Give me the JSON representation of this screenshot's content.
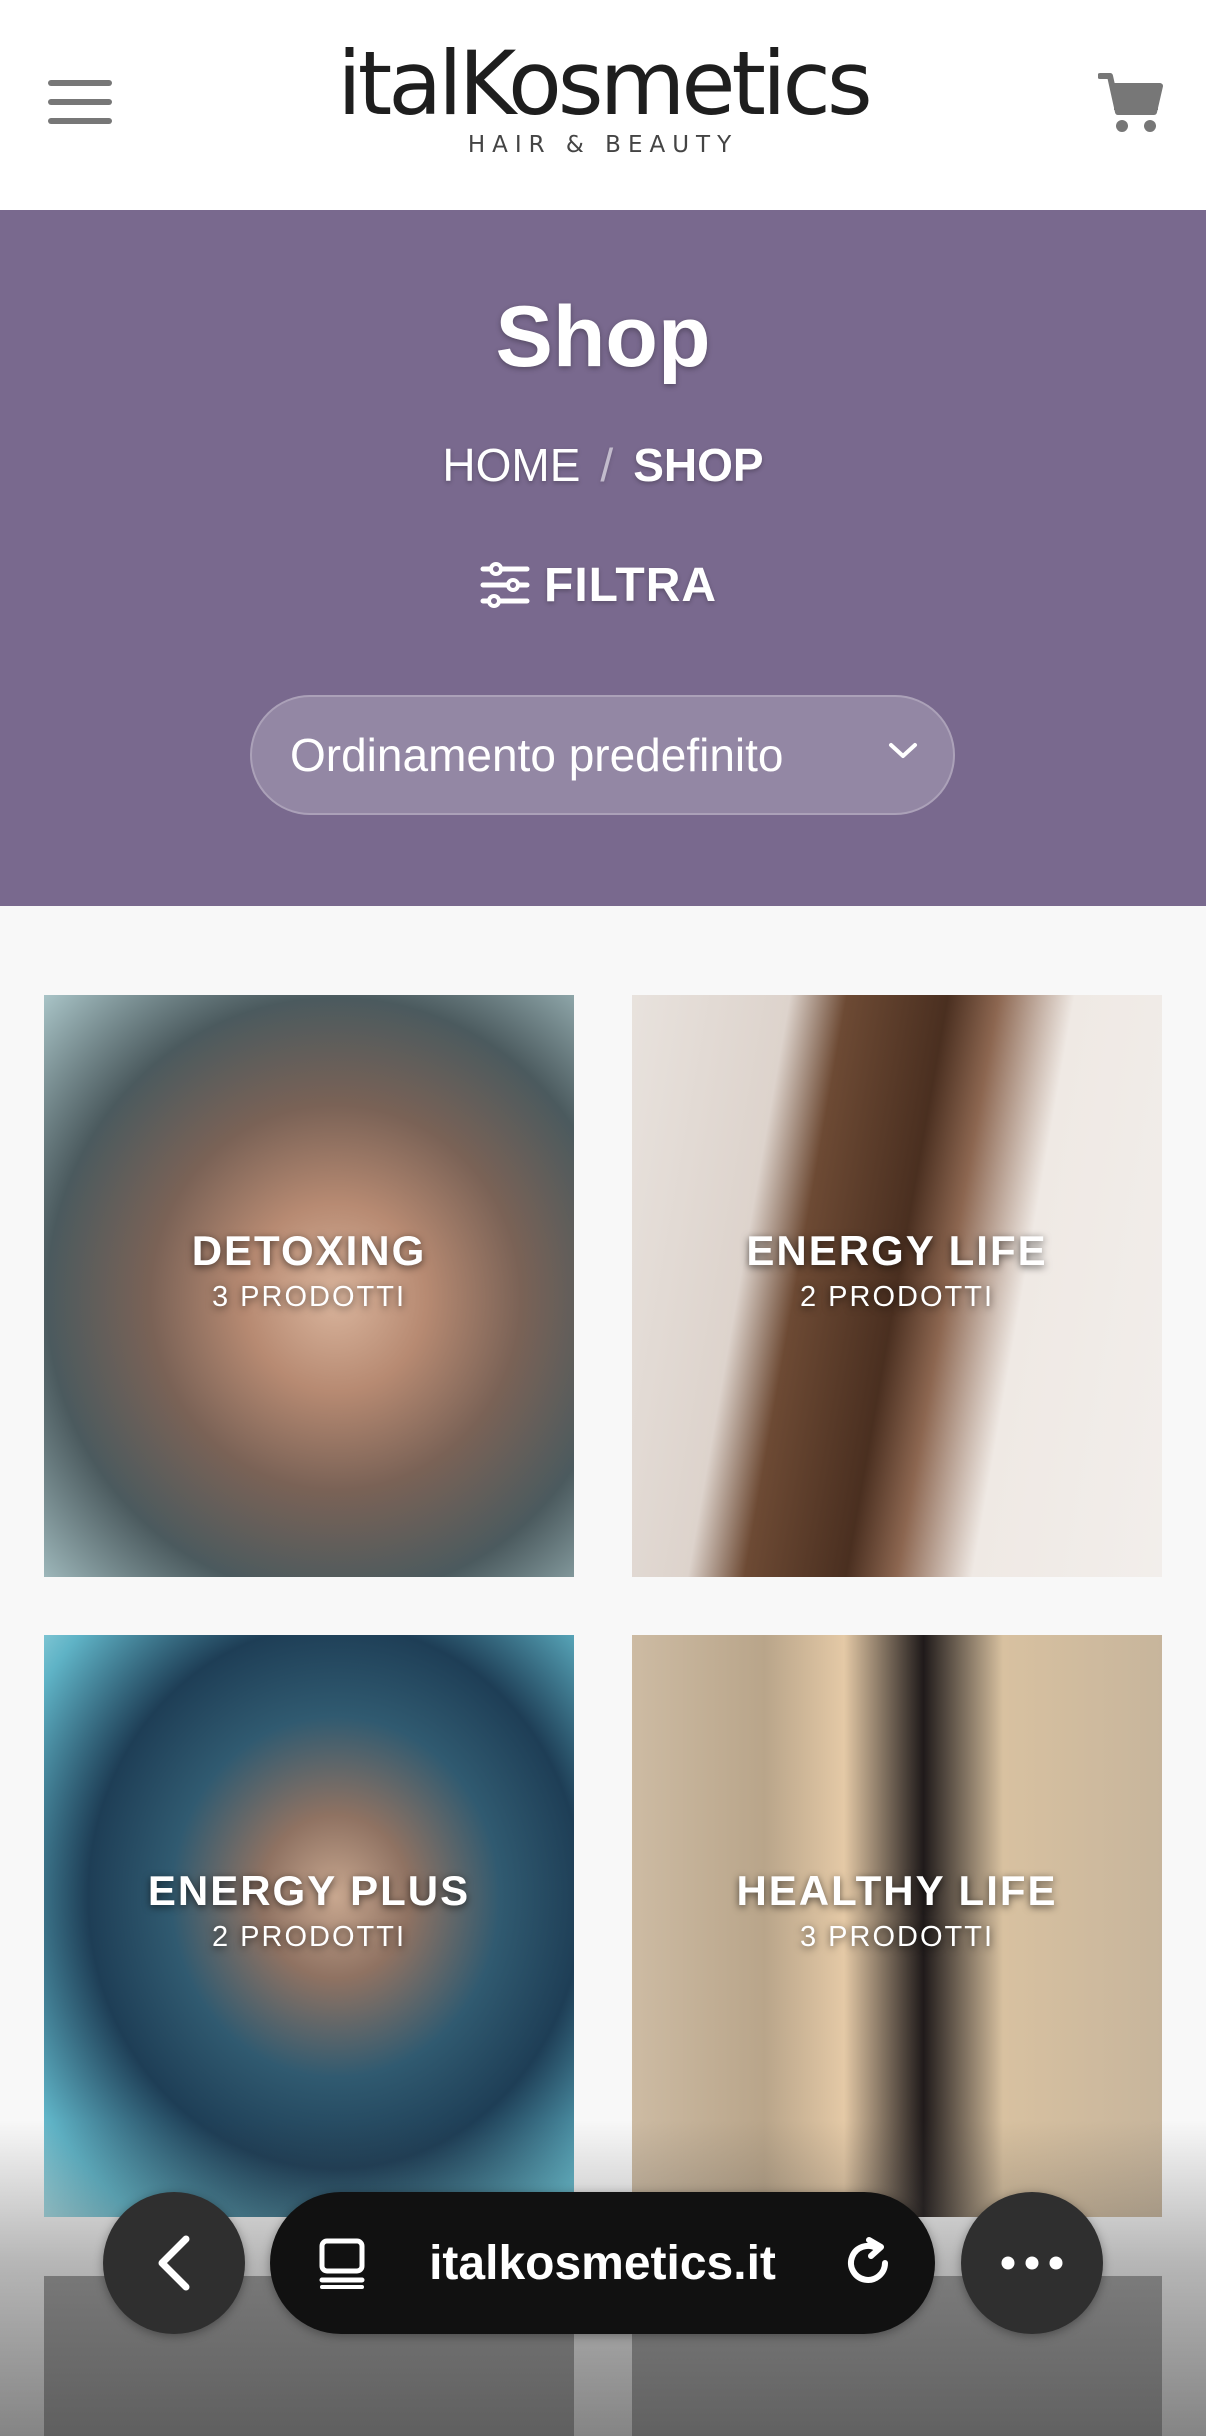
{
  "header": {
    "logo_text": "italKosmetics",
    "logo_tagline": "HAIR & BEAUTY"
  },
  "hero": {
    "title": "Shop",
    "breadcrumb": {
      "home": "HOME",
      "separator": "/",
      "current": "SHOP"
    },
    "filter_label": "FILTRA",
    "sort_selected": "Ordinamento predefinito"
  },
  "categories": [
    {
      "name": "DETOXING",
      "count": "3 PRODOTTI"
    },
    {
      "name": "ENERGY LIFE",
      "count": "2 PRODOTTI"
    },
    {
      "name": "ENERGY PLUS",
      "count": "2 PRODOTTI"
    },
    {
      "name": "HEALTHY LIFE",
      "count": "3 PRODOTTI"
    }
  ],
  "browser": {
    "url": "italkosmetics.it"
  },
  "colors": {
    "hero_bg": "#79698e",
    "page_bg": "#f8f8f8",
    "url_bar_bg": "#111111"
  },
  "icons": [
    "hamburger-menu-icon",
    "cart-icon",
    "filter-sliders-icon",
    "chevron-down-icon",
    "back-chevron-icon",
    "tabs-icon",
    "reload-icon",
    "more-icon"
  ]
}
